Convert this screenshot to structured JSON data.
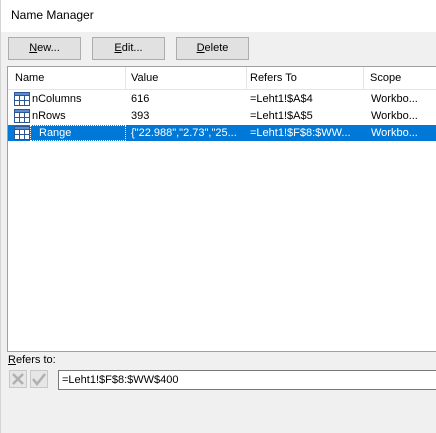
{
  "window": {
    "title": "Name Manager"
  },
  "toolbar": {
    "new": {
      "ul": "N",
      "rest": "ew..."
    },
    "edit": {
      "ul": "E",
      "rest": "dit..."
    },
    "delete": {
      "ul": "D",
      "rest": "elete"
    }
  },
  "table": {
    "columns": [
      "Name",
      "Value",
      "Refers To",
      "Scope"
    ],
    "rows": [
      {
        "name": "nColumns",
        "value": "616",
        "refers_to": "=Leht1!$A$4",
        "scope": "Workbo...",
        "icon": "name-range-icon",
        "selected": false
      },
      {
        "name": "nRows",
        "value": "393",
        "refers_to": "=Leht1!$A$5",
        "scope": "Workbo...",
        "icon": "name-range-icon",
        "selected": false
      },
      {
        "name": "Range",
        "value": "{\"22.988\",\"2.73\",\"25...",
        "refers_to": "=Leht1!$F$8:$WW...",
        "scope": "Workbo...",
        "icon": "name-range-icon",
        "selected": true
      }
    ]
  },
  "refers_to": {
    "label_ul": "R",
    "label_rest": "efers to:",
    "value": "=Leht1!$F$8:$WW$400",
    "cancel_icon": "cancel-x-icon",
    "confirm_icon": "check-icon"
  },
  "colors": {
    "selection": "#0078d7",
    "dialog_bg": "#f0f0f0"
  }
}
